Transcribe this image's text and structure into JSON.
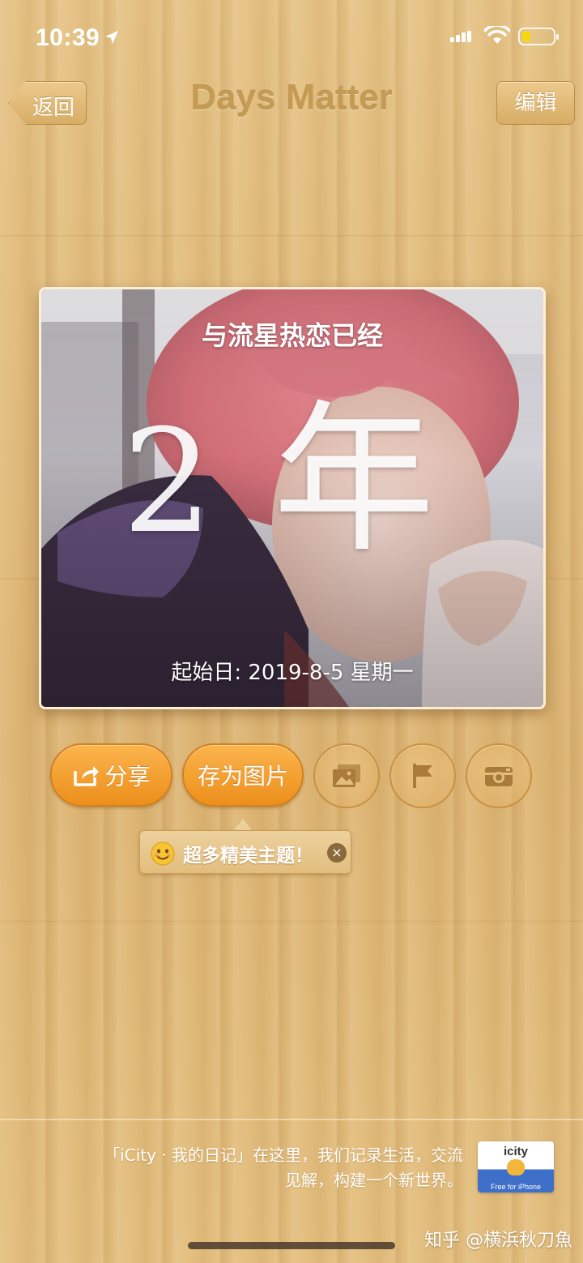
{
  "status_bar": {
    "time": "10:39"
  },
  "nav": {
    "back_label": "返回",
    "title": "Days Matter",
    "edit_label": "编辑"
  },
  "card": {
    "title": "与流星热恋已经",
    "number": "2",
    "unit": "年",
    "start_date": "起始日: 2019-8-5 星期一"
  },
  "actions": {
    "share_label": "分享",
    "save_image_label": "存为图片"
  },
  "tooltip": {
    "text": "超多精美主题！",
    "close": "×"
  },
  "banner": {
    "line1": "「iCity · 我的日记」在这里，我们记录生活，交流",
    "line2": "见解，构建一个新世界。",
    "app_name": "icity",
    "app_sub": "Free for iPhone"
  },
  "watermark": "知乎 @横浜秋刀魚",
  "colors": {
    "accent_orange": "#f5a53a",
    "nav_title": "#c59a53",
    "wood": "#e2bd7c"
  }
}
